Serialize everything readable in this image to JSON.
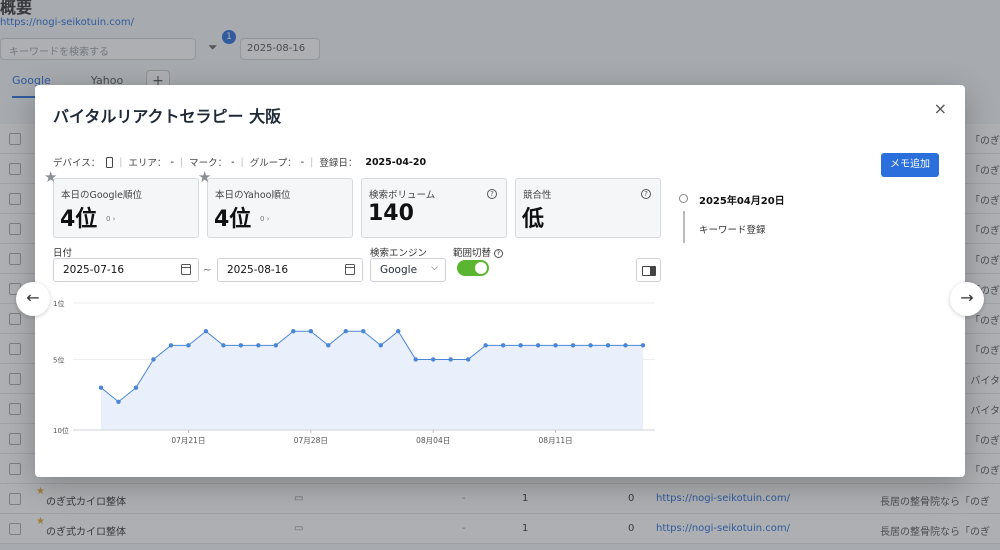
{
  "background": {
    "title": "概要",
    "url": "https://nogi-seikotuin.com/",
    "search_placeholder": "キーワードを検索する",
    "filter_badge": "1",
    "date": "2025-08-16",
    "tabs": [
      "Google",
      "Yahoo"
    ],
    "tab_add": "+",
    "rows": [
      {
        "name": "",
        "right": "「のぎ"
      },
      {
        "name": "",
        "right": "「のぎ"
      },
      {
        "name": "",
        "right": "「のぎ"
      },
      {
        "name": "",
        "right": "「のぎ"
      },
      {
        "name": "",
        "right": "「のぎ"
      },
      {
        "name": "",
        "right": "「のぎ"
      },
      {
        "name": "",
        "right": "「のぎ"
      },
      {
        "name": "",
        "right": "「のぎ"
      },
      {
        "name": "",
        "right": "バイタ"
      },
      {
        "name": "",
        "right": "バイタ"
      },
      {
        "name": "",
        "right": "「のぎ"
      },
      {
        "name": "",
        "right": "「のぎ"
      },
      {
        "name": "のぎ式カイロ整体",
        "right": "",
        "dash": "-",
        "num": "1",
        "num2": "0",
        "link": "https://nogi-seikotuin.com/",
        "desc": "長居の整骨院なら「のぎ"
      },
      {
        "name": "のぎ式カイロ整体",
        "right": "",
        "dash": "-",
        "num": "1",
        "num2": "0",
        "link": "https://nogi-seikotuin.com/",
        "desc": "長居の整骨院なら「のぎ"
      }
    ]
  },
  "modal": {
    "title": "バイタルリアクトセラピー 大阪",
    "close": "×",
    "meta": {
      "device_label": "デバイス：",
      "area_label": "エリア：",
      "area_value": "-",
      "mark_label": "マーク：",
      "mark_value": "-",
      "group_label": "グループ：",
      "group_value": "-",
      "registered_label": "登録日：",
      "registered_value": "2025-04-20"
    },
    "memo_button": "メモ追加",
    "cards": [
      {
        "label": "本日のGoogle順位",
        "value": "4位",
        "sub": "0 ›"
      },
      {
        "label": "本日のYahoo順位",
        "value": "4位",
        "sub": "0 ›"
      },
      {
        "label": "検索ボリューム",
        "value": "140"
      },
      {
        "label": "競合性",
        "value": "低"
      }
    ],
    "help_glyph": "?",
    "date_label": "日付",
    "date_from": "2025-07-16",
    "date_to": "2025-08-16",
    "tilde": "~",
    "engine_label": "検索エンジン",
    "engine_value": "Google",
    "engine_chevron": "⌵",
    "range_label": "範囲切替",
    "timeline": {
      "date": "2025年04月20日",
      "text": "キーワード登録"
    }
  },
  "nav": {
    "prev": "←",
    "next": "→"
  },
  "chart_data": {
    "type": "area",
    "x": [
      "07-16",
      "07-17",
      "07-18",
      "07-19",
      "07-20",
      "07-21",
      "07-22",
      "07-23",
      "07-24",
      "07-25",
      "07-26",
      "07-27",
      "07-28",
      "07-29",
      "07-30",
      "07-31",
      "08-01",
      "08-02",
      "08-03",
      "08-04",
      "08-05",
      "08-06",
      "08-07",
      "08-08",
      "08-09",
      "08-10",
      "08-11",
      "08-12",
      "08-13",
      "08-14",
      "08-15",
      "08-16"
    ],
    "values": [
      7,
      8,
      7,
      5,
      4,
      4,
      3,
      4,
      4,
      4,
      4,
      3,
      3,
      4,
      3,
      3,
      4,
      3,
      5,
      5,
      5,
      5,
      4,
      4,
      4,
      4,
      4,
      4,
      4,
      4,
      4,
      4
    ],
    "y_tick_labels": [
      "1位",
      "5位",
      "10位"
    ],
    "y_ticks": [
      1,
      5,
      10
    ],
    "ylim": [
      1,
      10
    ],
    "y_inverted": true,
    "x_tick_labels": [
      "07月21日",
      "07月28日",
      "08月04日",
      "08月11日"
    ],
    "x_ticks": [
      "07-21",
      "07-28",
      "08-04",
      "08-11"
    ],
    "line_color": "#4a86d8",
    "fill_color": "#e9f0fb",
    "grid": true
  }
}
